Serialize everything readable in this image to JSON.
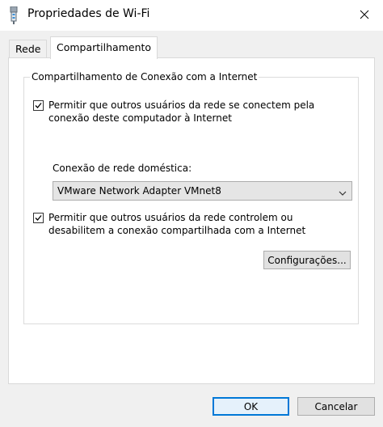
{
  "window": {
    "title": "Propriedades de Wi-Fi",
    "close_glyph": "✕",
    "icon": "network-adapter-icon"
  },
  "tabs": [
    {
      "label": "Rede",
      "active": false
    },
    {
      "label": "Compartilhamento",
      "active": true
    }
  ],
  "sharing": {
    "group_title": "Compartilhamento de Conexão com a Internet",
    "allow_connect": {
      "checked": true,
      "label": "Permitir que outros usuários da rede se conectem pela conexão deste computador à Internet"
    },
    "home_network_label": "Conexão de rede doméstica:",
    "home_network_value": "VMware Network Adapter VMnet8",
    "allow_control": {
      "checked": true,
      "label": "Permitir que outros usuários da rede controlem ou desabilitem a conexão compartilhada com a Internet"
    },
    "settings_button": "Configurações..."
  },
  "footer": {
    "ok_label": "OK",
    "cancel_label": "Cancelar"
  },
  "colors": {
    "client_bg": "#f0f0f0",
    "panel_bg": "#ffffff",
    "default_button_border": "#0078d7"
  }
}
